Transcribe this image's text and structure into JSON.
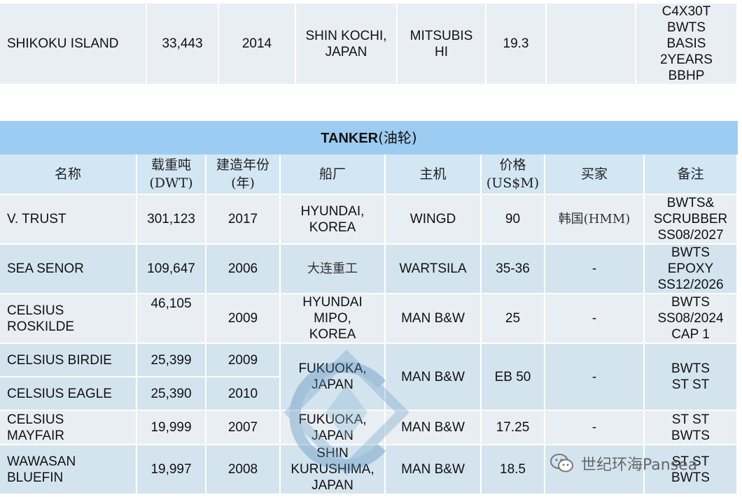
{
  "top_row": {
    "name": "SHIKOKU ISLAND",
    "dwt": "33,443",
    "year": "2014",
    "yard": "SHIN KOCHI,\nJAPAN",
    "engine": "MITSUBIS\nHI",
    "price": "19.3",
    "buyer": "",
    "remarks": "C4X30T\nBWTS\nBASIS\n2YEARS\nBBHP"
  },
  "section_title": {
    "en": "TANKER",
    "cn": "(油轮)"
  },
  "headers": {
    "name": "名称",
    "dwt": "载重吨\n(DWT)",
    "year": "建造年份\n(年)",
    "yard": "船厂",
    "engine": "主机",
    "price": "价格\n(US$M)",
    "buyer": "买家",
    "remarks": "备注"
  },
  "rows": [
    {
      "name": "V. TRUST",
      "dwt": "301,123",
      "year": "2017",
      "yard": "HYUNDAI,\nKOREA",
      "engine": "WINGD",
      "price": "90",
      "buyer": "韩国(HMM)",
      "remarks": "BWTS&\nSCRUBBER\nSS08/2027"
    },
    {
      "name": "SEA SENOR",
      "dwt": "109,647",
      "year": "2006",
      "yard": "大连重工",
      "engine": "WARTSILA",
      "price": "35-36",
      "buyer": "-",
      "remarks": "BWTS\nEPOXY\nSS12/2026"
    },
    {
      "name": "CELSIUS\nROSKILDE",
      "dwt": "46,105",
      "year": "2009",
      "yard": "HYUNDAI\nMIPO,\nKOREA",
      "engine": "MAN B&W",
      "price": "25",
      "buyer": "-",
      "remarks": "BWTS\nSS08/2024\nCAP 1"
    },
    {
      "name": "CELSIUS BIRDIE",
      "dwt": "25,399",
      "year": "2009",
      "yard": "FUKUOKA,\nJAPAN",
      "engine": "MAN B&W",
      "price": "EB 50",
      "buyer": "-",
      "remarks": "BWTS\nST ST"
    },
    {
      "name": "CELSIUS EAGLE",
      "dwt": "25,390",
      "year": "2010"
    },
    {
      "name": "CELSIUS\nMAYFAIR",
      "dwt": "19,999",
      "year": "2007",
      "yard": "FUKUOKA,\nJAPAN",
      "engine": "MAN B&W",
      "price": "17.25",
      "buyer": "-",
      "remarks": "ST ST\nBWTS"
    },
    {
      "name": "WAWASAN\nBLUEFIN",
      "dwt": "19,997",
      "year": "2008",
      "yard": "SHIN\nKURUSHIMA,\nJAPAN",
      "engine": "MAN B&W",
      "price": "18.5",
      "buyer": "",
      "remarks": "ST ST\nBWTS"
    }
  ],
  "watermark": {
    "icon": "wechat-icon",
    "text": "世纪环海Pansea"
  }
}
